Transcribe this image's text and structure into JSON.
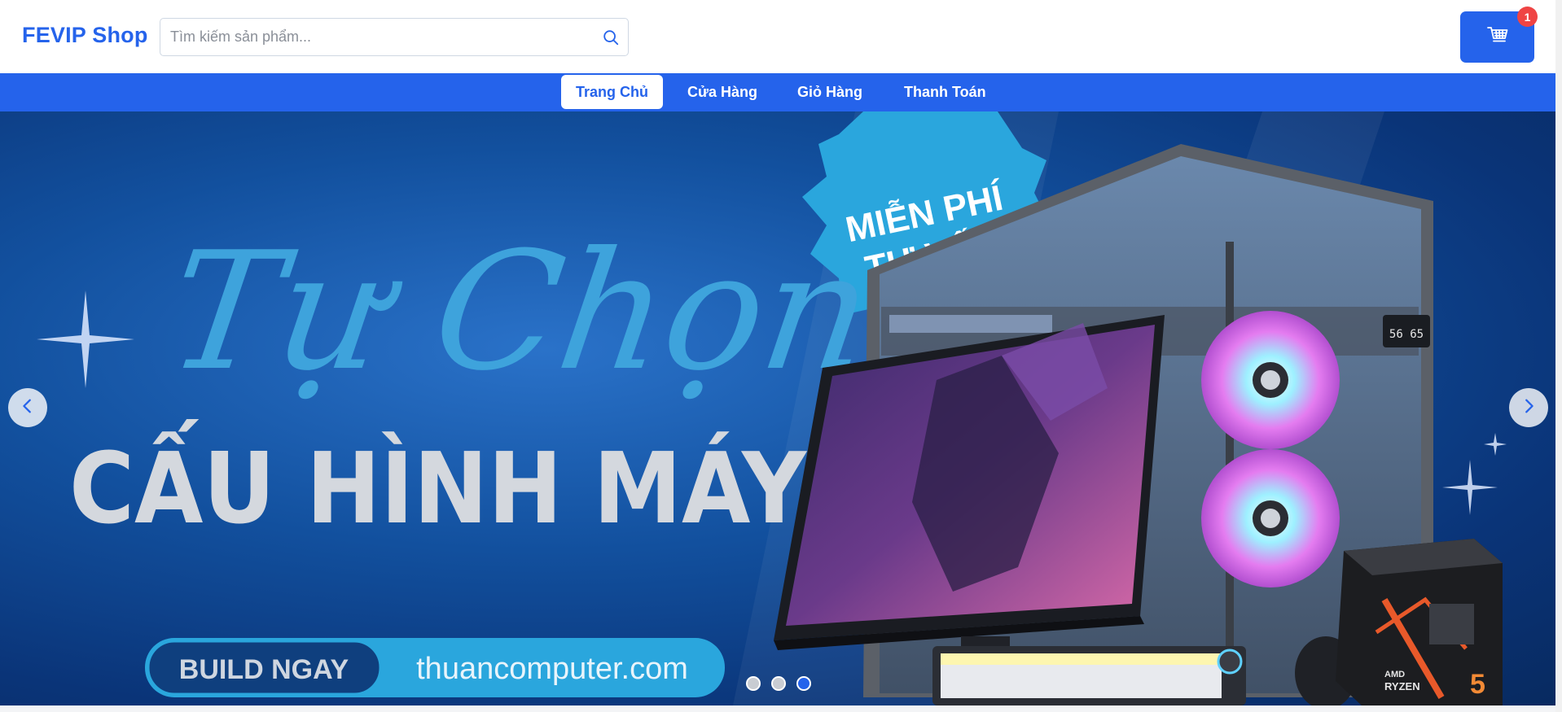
{
  "header": {
    "logo": "FEVIP Shop",
    "search": {
      "placeholder": "Tìm kiếm sản phẩm...",
      "value": "",
      "icon": "search-icon"
    },
    "cart": {
      "icon": "cart-icon",
      "badge_count": "1",
      "color": "#2563eb",
      "badge_color": "#ef4444"
    }
  },
  "nav": {
    "items": [
      {
        "label": "Trang Chủ",
        "active": true
      },
      {
        "label": "Cửa Hàng"
      },
      {
        "label": "Giỏ Hàng"
      },
      {
        "label": "Thanh Toán"
      }
    ],
    "background": "#2563eb"
  },
  "banner": {
    "badge_line1": "MIỄN PHÍ",
    "badge_line2": "TƯ VẤN",
    "script_title": "Tự Chọn",
    "headline": "CẤU HÌNH MÁY",
    "cta_label": "BUILD NGAY",
    "cta_url": "thuancomputer.com",
    "case_display": "56 65",
    "cpu_brand": "AMD",
    "cpu_model": "RYZEN",
    "cpu_tier": "5",
    "prev_icon": "chevron-left-icon",
    "next_icon": "chevron-right-icon",
    "slide_count": 3,
    "active_slide": 3
  }
}
